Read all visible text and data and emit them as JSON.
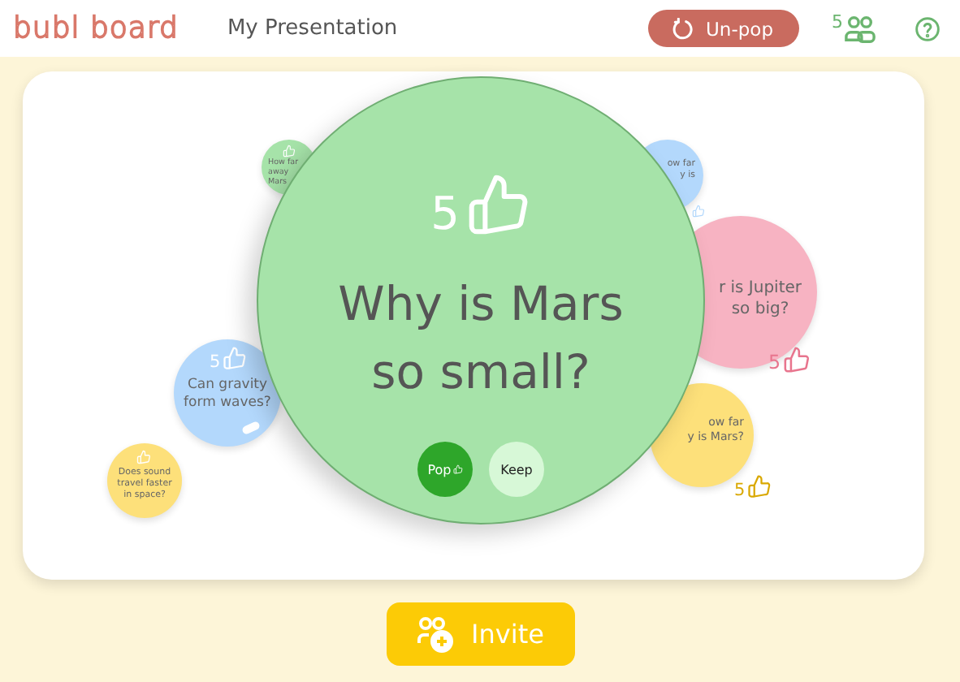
{
  "header": {
    "logo": "bubl board",
    "title": "My Presentation",
    "unpop_button": "Un-pop",
    "participant_count": "5"
  },
  "bubbles": [
    {
      "kind": "minor",
      "color": "#a6e3a9",
      "lines": [
        "How far",
        "away",
        "Mars"
      ]
    },
    {
      "kind": "minor",
      "color": "#b3d8fc",
      "lines": [
        "ow far",
        "y is"
      ]
    },
    {
      "kind": "minor",
      "color": "#f7b3c2",
      "votes": "5",
      "lines": [
        "r is Jupiter",
        "so big?"
      ]
    },
    {
      "kind": "minor",
      "color": "#b3d8fc",
      "votes": "5",
      "lines": [
        "Can gravity",
        "form waves?"
      ]
    },
    {
      "kind": "minor",
      "color": "#fde07a",
      "lines": [
        "Does sound",
        "travel faster",
        "in space?"
      ]
    },
    {
      "kind": "minor",
      "color": "#fde07a",
      "votes": "5",
      "lines": [
        "ow far",
        "y is Mars?"
      ]
    },
    {
      "kind": "focus",
      "color": "#a6e3a9",
      "votes": "5",
      "lines": [
        "Why is Mars",
        "so small?"
      ],
      "actions": [
        {
          "label": "Pop",
          "kind": "primary"
        },
        {
          "label": "Keep",
          "kind": "secondary"
        }
      ]
    }
  ],
  "invite_button": "Invite"
}
